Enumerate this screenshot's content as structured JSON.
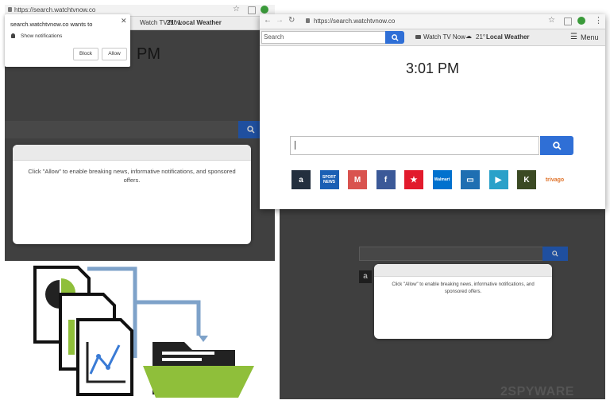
{
  "back_window": {
    "url": "https://search.watchtvnow.co",
    "toolbar": {
      "watch_tv": "Watch TV Now",
      "weather": "21° Local Weather"
    },
    "time_partial": "PM",
    "modal_text": "Click \"Allow\" to enable breaking news, informative notifications, and sponsored offers."
  },
  "notification": {
    "title": "search.watchtvnow.co wants to",
    "item": "Show notifications",
    "block_label": "Block",
    "allow_label": "Allow"
  },
  "front_window": {
    "url": "https://search.watchtvnow.co",
    "search_placeholder": "Search",
    "toolbar": {
      "watch_tv": "Watch TV Now",
      "weather_temp": "21°",
      "weather_label": "Local Weather",
      "menu": "Menu"
    },
    "time": "3:01 PM",
    "shortcuts": [
      {
        "name": "amazon",
        "label": "a",
        "color": "#232f3e"
      },
      {
        "name": "sport-news",
        "label": "SPORT NEWS",
        "color": "#1a5fb4"
      },
      {
        "name": "gmail",
        "label": "M",
        "color": "#d9534f"
      },
      {
        "name": "facebook",
        "label": "f",
        "color": "#3b5998"
      },
      {
        "name": "macys",
        "label": "★",
        "color": "#e21a2c"
      },
      {
        "name": "walmart",
        "label": "Walmart",
        "color": "#0071ce"
      },
      {
        "name": "tv",
        "label": "▭",
        "color": "#1f6fb2"
      },
      {
        "name": "video",
        "label": "▶",
        "color": "#2aa1c9"
      },
      {
        "name": "kik",
        "label": "K",
        "color": "#3b4a23"
      },
      {
        "name": "trivago",
        "label": "trivago",
        "color": "#ffffff"
      }
    ]
  },
  "bottom_window": {
    "modal_text": "Click \"Allow\" to enable breaking news, informative notifications, and sponsored offers."
  },
  "watermark": "2SPYWARE"
}
